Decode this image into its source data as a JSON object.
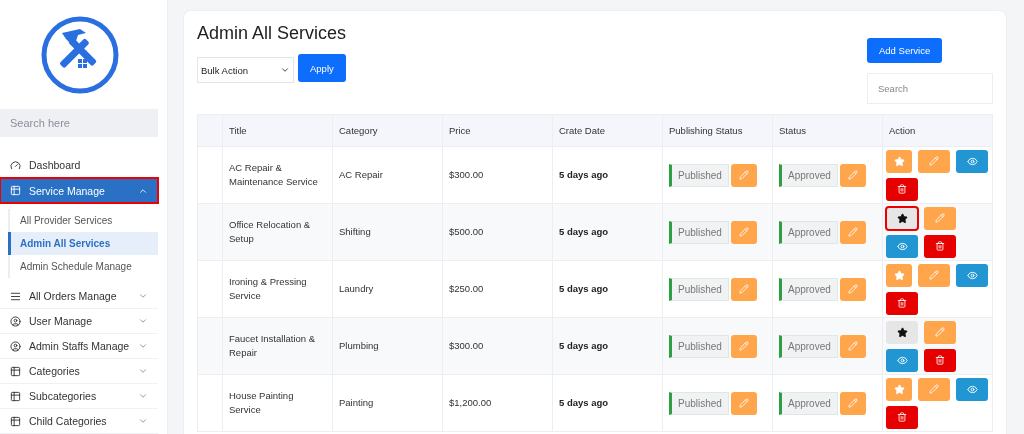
{
  "sidebar": {
    "search": {
      "placeholder": "Search here"
    },
    "items": [
      {
        "label": "Dashboard",
        "kind": "gauge",
        "selected": false,
        "highlighted": false
      },
      {
        "label": "Service Manage",
        "kind": "table",
        "selected": true,
        "expanded": true,
        "highlighted": true,
        "children": [
          {
            "label": "All Provider Services",
            "selected": false
          },
          {
            "label": "Admin All Services",
            "selected": true
          },
          {
            "label": "Admin Schedule Manage",
            "selected": false
          }
        ]
      },
      {
        "label": "All Orders Manage",
        "kind": "lines",
        "selected": false,
        "expanded": false,
        "highlighted": false
      },
      {
        "label": "User Manage",
        "kind": "user",
        "selected": false,
        "expanded": false,
        "highlighted": false
      },
      {
        "label": "Admin Staffs Manage",
        "kind": "user",
        "selected": false,
        "expanded": false,
        "highlighted": false
      },
      {
        "label": "Categories",
        "kind": "table",
        "selected": false,
        "expanded": false,
        "highlighted": false
      },
      {
        "label": "Subcategories",
        "kind": "table",
        "selected": false,
        "expanded": false,
        "highlighted": false
      },
      {
        "label": "Child Categories",
        "kind": "table",
        "selected": false,
        "expanded": false,
        "highlighted": false
      }
    ]
  },
  "page": {
    "title": "Admin All Services",
    "bulk_action": "Bulk Action",
    "apply": "Apply",
    "add_button": "Add Service",
    "search": {
      "placeholder": "Search"
    }
  },
  "table": {
    "columns": [
      "Title",
      "Category",
      "Price",
      "Crate Date",
      "Publishing Status",
      "Status",
      "Action"
    ],
    "rows": [
      {
        "title": "AC Repair & Maintenance Service",
        "category": "AC Repair",
        "price": "$300.00",
        "date": "5 days ago",
        "publishing": "Published",
        "status": "Approved",
        "featured": false,
        "highlighted": false
      },
      {
        "title": "Office Relocation & Setup",
        "category": "Shifting",
        "price": "$500.00",
        "date": "5 days ago",
        "publishing": "Published",
        "status": "Approved",
        "featured": true,
        "highlighted": true
      },
      {
        "title": "Ironing & Pressing Service",
        "category": "Laundry",
        "price": "$250.00",
        "date": "5 days ago",
        "publishing": "Published",
        "status": "Approved",
        "featured": false,
        "highlighted": false
      },
      {
        "title": "Faucet Installation & Repair",
        "category": "Plumbing",
        "price": "$300.00",
        "date": "5 days ago",
        "publishing": "Published",
        "status": "Approved",
        "featured": true,
        "highlighted": false
      },
      {
        "title": "House Painting Service",
        "category": "Painting",
        "price": "$1,200.00",
        "date": "5 days ago",
        "publishing": "Published",
        "status": "Approved",
        "featured": false,
        "highlighted": false
      }
    ]
  }
}
